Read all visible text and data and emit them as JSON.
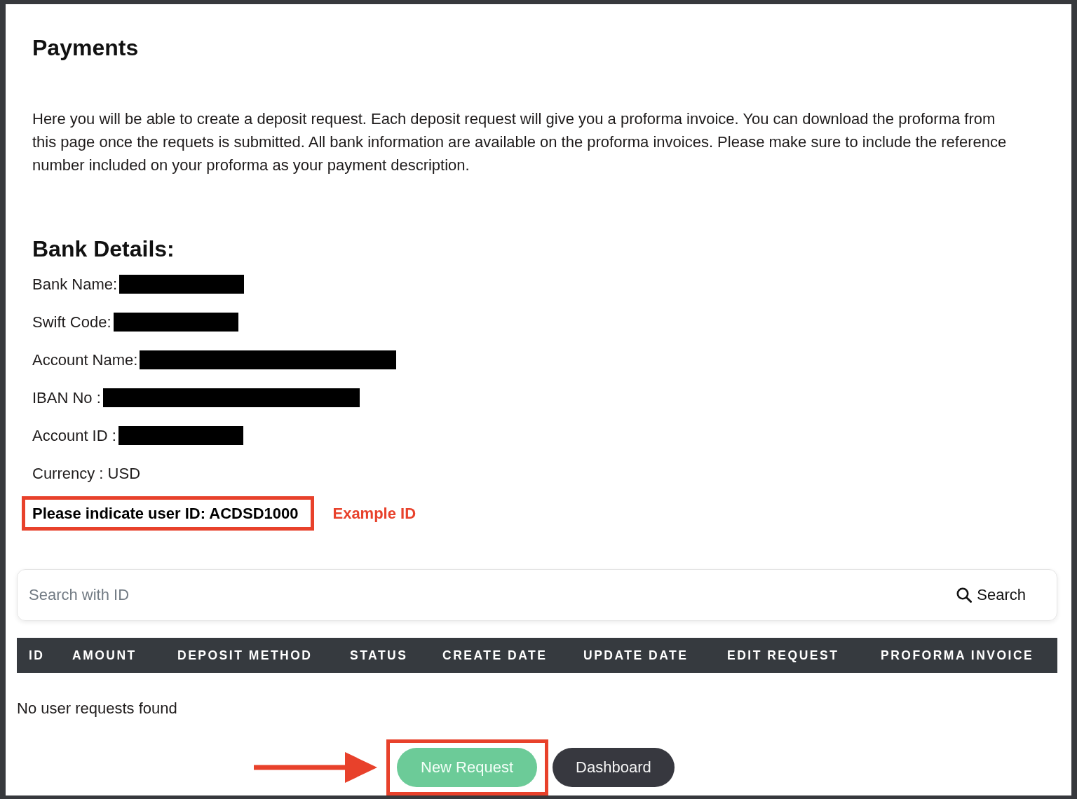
{
  "page": {
    "title": "Payments",
    "intro": "Here you will be able to create a deposit request. Each deposit request will give you a proforma invoice. You can download the proforma from this page once the requets is submitted. All bank information are available on the proforma invoices. Please make sure to include the reference number included on your proforma as your payment description."
  },
  "bank_details": {
    "heading": "Bank Details:",
    "rows": [
      {
        "label": "Bank Name:",
        "redacted": true
      },
      {
        "label": "Swift Code:",
        "redacted": true
      },
      {
        "label": "Account Name:",
        "redacted": true
      },
      {
        "label": "IBAN No :",
        "redacted": true
      },
      {
        "label": "Account ID :",
        "redacted": true
      },
      {
        "label": "Currency : USD",
        "redacted": false
      }
    ]
  },
  "notice": {
    "text": "Please indicate user ID: ACDSD1000",
    "highlighted": true
  },
  "annotation": {
    "text": "Example ID"
  },
  "search": {
    "placeholder": "Search with ID",
    "button": "Search"
  },
  "table": {
    "columns": [
      "ID",
      "AMOUNT",
      "DEPOSIT METHOD",
      "STATUS",
      "CREATE DATE",
      "UPDATE DATE",
      "EDIT REQUEST",
      "PROFORMA INVOICE"
    ],
    "empty_message": "No user requests found"
  },
  "buttons": [
    {
      "label": "New Request",
      "kind": "primary",
      "highlighted": true,
      "arrow": true
    },
    {
      "label": "Dashboard",
      "kind": "secondary",
      "highlighted": false,
      "arrow": false
    }
  ]
}
